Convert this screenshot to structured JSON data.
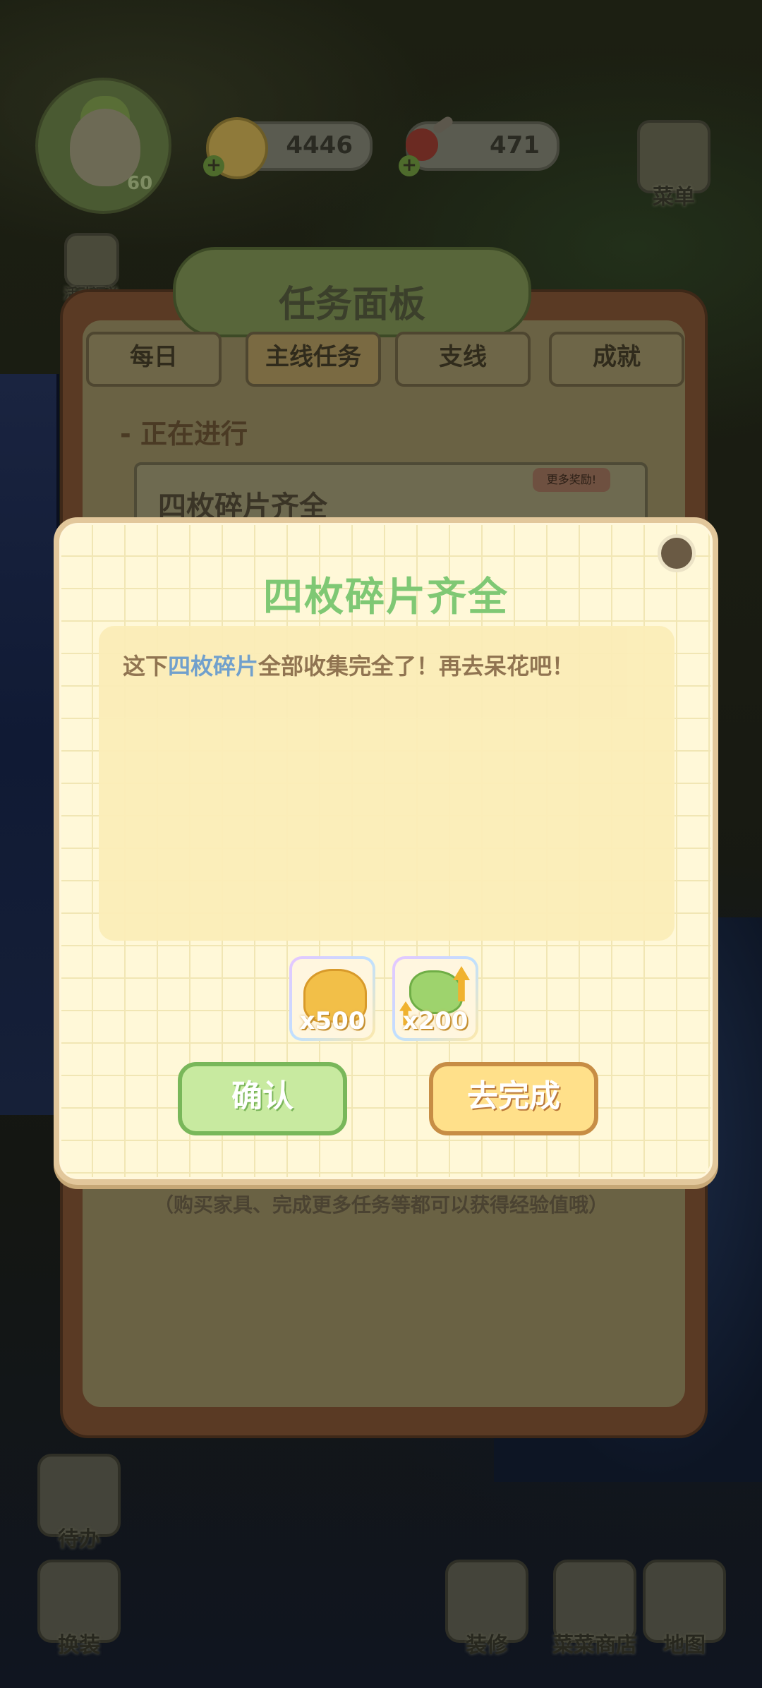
{
  "hud": {
    "level": "60",
    "coins": "4446",
    "meat": "471",
    "menu_label": "菜单",
    "events_label": "活动汇总"
  },
  "task_panel": {
    "title": "任务面板",
    "tabs": [
      {
        "label": "每日"
      },
      {
        "label": "主线任务"
      },
      {
        "label": "支线"
      },
      {
        "label": "成就"
      }
    ],
    "section_label": "- 正在进行",
    "task_title": "四枚碎片齐全",
    "more_reward": "更多奖励!",
    "hint": "（购买家具、完成更多任务等都可以获得经验值哦）"
  },
  "dialog": {
    "title": "四枚碎片齐全",
    "text_prefix": "这下",
    "text_highlight": "四枚碎片",
    "text_suffix": "全部收集完全了！再去呆花吧！",
    "rewards": [
      {
        "icon": "gold-coins-icon",
        "qty": "x500"
      },
      {
        "icon": "vegetable-exp-icon",
        "qty": "x200"
      }
    ],
    "confirm_label": "确认",
    "go_complete_label": "去完成"
  },
  "bottom_nav": {
    "todo": "待办",
    "dress": "换装",
    "decorate": "装修",
    "shop": "菜菜商店",
    "map": "地图"
  }
}
